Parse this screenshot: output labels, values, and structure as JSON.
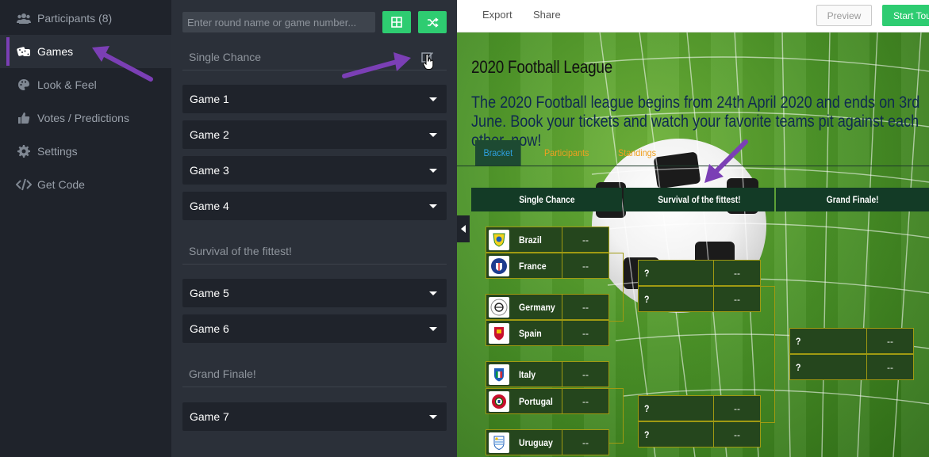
{
  "sidebar": {
    "items": [
      {
        "label": "Participants (8)",
        "icon": "users-icon"
      },
      {
        "label": "Games",
        "icon": "dice-icon"
      },
      {
        "label": "Look & Feel",
        "icon": "palette-icon"
      },
      {
        "label": "Votes / Predictions",
        "icon": "thumbs-up-icon"
      },
      {
        "label": "Settings",
        "icon": "gear-icon"
      },
      {
        "label": "Get Code",
        "icon": "code-icon"
      }
    ],
    "active": "Games"
  },
  "panel": {
    "search_placeholder": "Enter round name or game number...",
    "rounds": [
      {
        "name": "Single Chance",
        "games": [
          "Game 1",
          "Game 2",
          "Game 3",
          "Game 4"
        ]
      },
      {
        "name": "Survival of the fittest!",
        "games": [
          "Game 5",
          "Game 6"
        ]
      },
      {
        "name": "Grand Finale!",
        "games": [
          "Game 7"
        ]
      }
    ]
  },
  "toolbar": {
    "export_label": "Export",
    "share_label": "Share",
    "preview_label": "Preview",
    "start_label": "Start Tour"
  },
  "preview": {
    "title": "2020 Football League",
    "description": "The 2020 Football league begins from 24th April 2020 and ends on 3rd June. Book your tickets and watch your favorite teams pit against each other, now!",
    "tabs": [
      "Bracket",
      "Participants",
      "Standings"
    ],
    "round_headers": [
      "Single Chance",
      "Survival of the fittest!",
      "Grand Finale!"
    ],
    "round1_slots": [
      {
        "team": "Brazil",
        "score": "--"
      },
      {
        "team": "France",
        "score": "--"
      },
      {
        "team": "Germany",
        "score": "--"
      },
      {
        "team": "Spain",
        "score": "--"
      },
      {
        "team": "Italy",
        "score": "--"
      },
      {
        "team": "Portugal",
        "score": "--"
      },
      {
        "team": "Uruguay",
        "score": "--"
      }
    ],
    "round2_slots": [
      {
        "team": "?",
        "score": "--"
      },
      {
        "team": "?",
        "score": "--"
      },
      {
        "team": "?",
        "score": "--"
      },
      {
        "team": "?",
        "score": "--"
      }
    ],
    "round3_slots": [
      {
        "team": "?",
        "score": "--"
      },
      {
        "team": "?",
        "score": "--"
      }
    ]
  },
  "colors": {
    "accent_green": "#2ecc71",
    "annotation_purple": "#7b3fb5",
    "tab_active_text": "#2ea0e0",
    "tab_inactive_text": "#f0a020"
  }
}
